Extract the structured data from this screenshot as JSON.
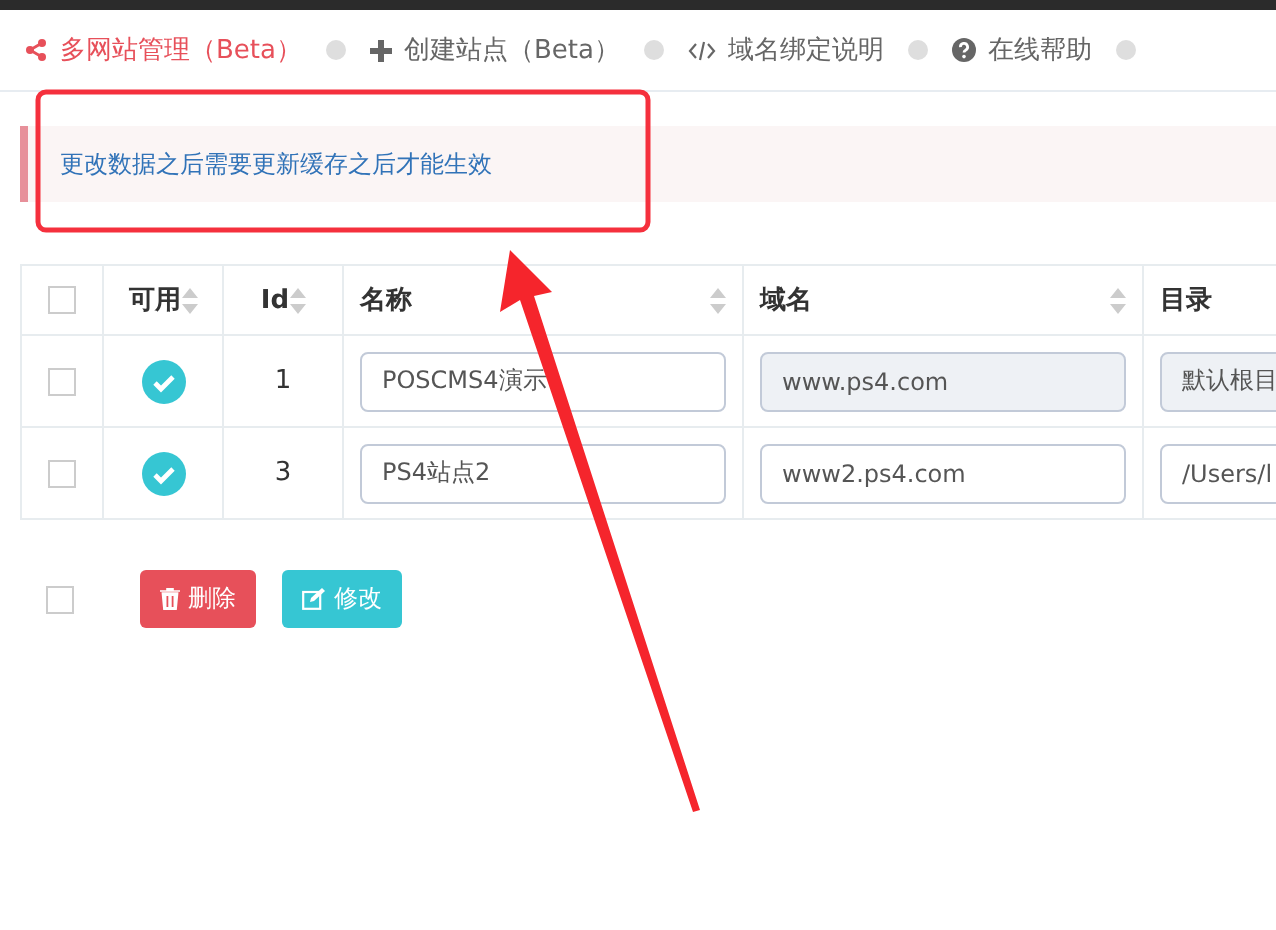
{
  "nav": {
    "items": [
      {
        "label": "多网站管理（Beta）",
        "selected": true
      },
      {
        "label": "创建站点（Beta）",
        "selected": false
      },
      {
        "label": "域名绑定说明",
        "selected": false
      },
      {
        "label": "在线帮助",
        "selected": false
      }
    ]
  },
  "alert": {
    "text": "更改数据之后需要更新缓存之后才能生效"
  },
  "table": {
    "select_all_checked": false,
    "columns": [
      {
        "label": "可用",
        "sortable": true
      },
      {
        "label": "Id",
        "sortable": true
      },
      {
        "label": "名称",
        "sortable": true
      },
      {
        "label": "域名",
        "sortable": true
      },
      {
        "label": "目录",
        "sortable": false
      }
    ],
    "rows": [
      {
        "checked": false,
        "enabled": true,
        "id": "1",
        "name": {
          "value": "POSCMS4演示",
          "disabled": false
        },
        "domain": {
          "value": "www.ps4.com",
          "disabled": true
        },
        "directory": {
          "value": "默认根目",
          "disabled": true
        }
      },
      {
        "checked": false,
        "enabled": true,
        "id": "3",
        "name": {
          "value": "PS4站点2",
          "disabled": false
        },
        "domain": {
          "value": "www2.ps4.com",
          "disabled": false
        },
        "directory": {
          "value": "/Users/l",
          "disabled": false
        }
      }
    ]
  },
  "footer": {
    "select_all_checked": false,
    "buttons": [
      {
        "kind": "delete",
        "label": "删除"
      },
      {
        "kind": "edit",
        "label": "修改"
      }
    ]
  }
}
